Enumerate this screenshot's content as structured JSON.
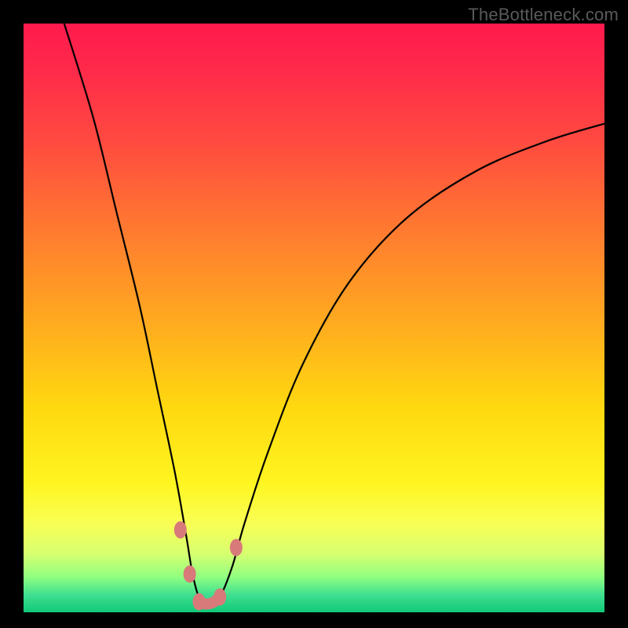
{
  "watermark": "TheBottleneck.com",
  "chart_data": {
    "type": "line",
    "title": "",
    "xlabel": "",
    "ylabel": "",
    "xlim": [
      0,
      100
    ],
    "ylim": [
      0,
      100
    ],
    "series": [
      {
        "name": "bottleneck-curve",
        "x": [
          7,
          12,
          16,
          20,
          23,
          26,
          28,
          29,
          30,
          31,
          32,
          34,
          36,
          38,
          42,
          48,
          56,
          66,
          78,
          90,
          100
        ],
        "y": [
          100,
          84,
          68,
          52,
          38,
          24,
          13,
          7,
          3,
          1,
          1,
          3,
          8,
          15,
          27,
          42,
          56,
          67,
          75,
          80,
          83
        ]
      }
    ],
    "markers": [
      {
        "name": "left-top-marker",
        "x": 27.0,
        "y": 14.0
      },
      {
        "name": "left-bottom-marker",
        "x": 28.6,
        "y": 6.5
      },
      {
        "name": "min-left-marker",
        "x": 30.2,
        "y": 1.8
      },
      {
        "name": "min-right-marker",
        "x": 33.8,
        "y": 2.6
      },
      {
        "name": "right-dot-marker",
        "x": 36.6,
        "y": 11.0
      }
    ],
    "trough_segment": {
      "x0": 30.2,
      "y0": 1.8,
      "x1": 33.8,
      "y1": 2.6
    },
    "colors": {
      "curve": "#000000",
      "marker": "#d87a7a",
      "gradient_top": "#ff1a4d",
      "gradient_bottom": "#10c878"
    }
  }
}
